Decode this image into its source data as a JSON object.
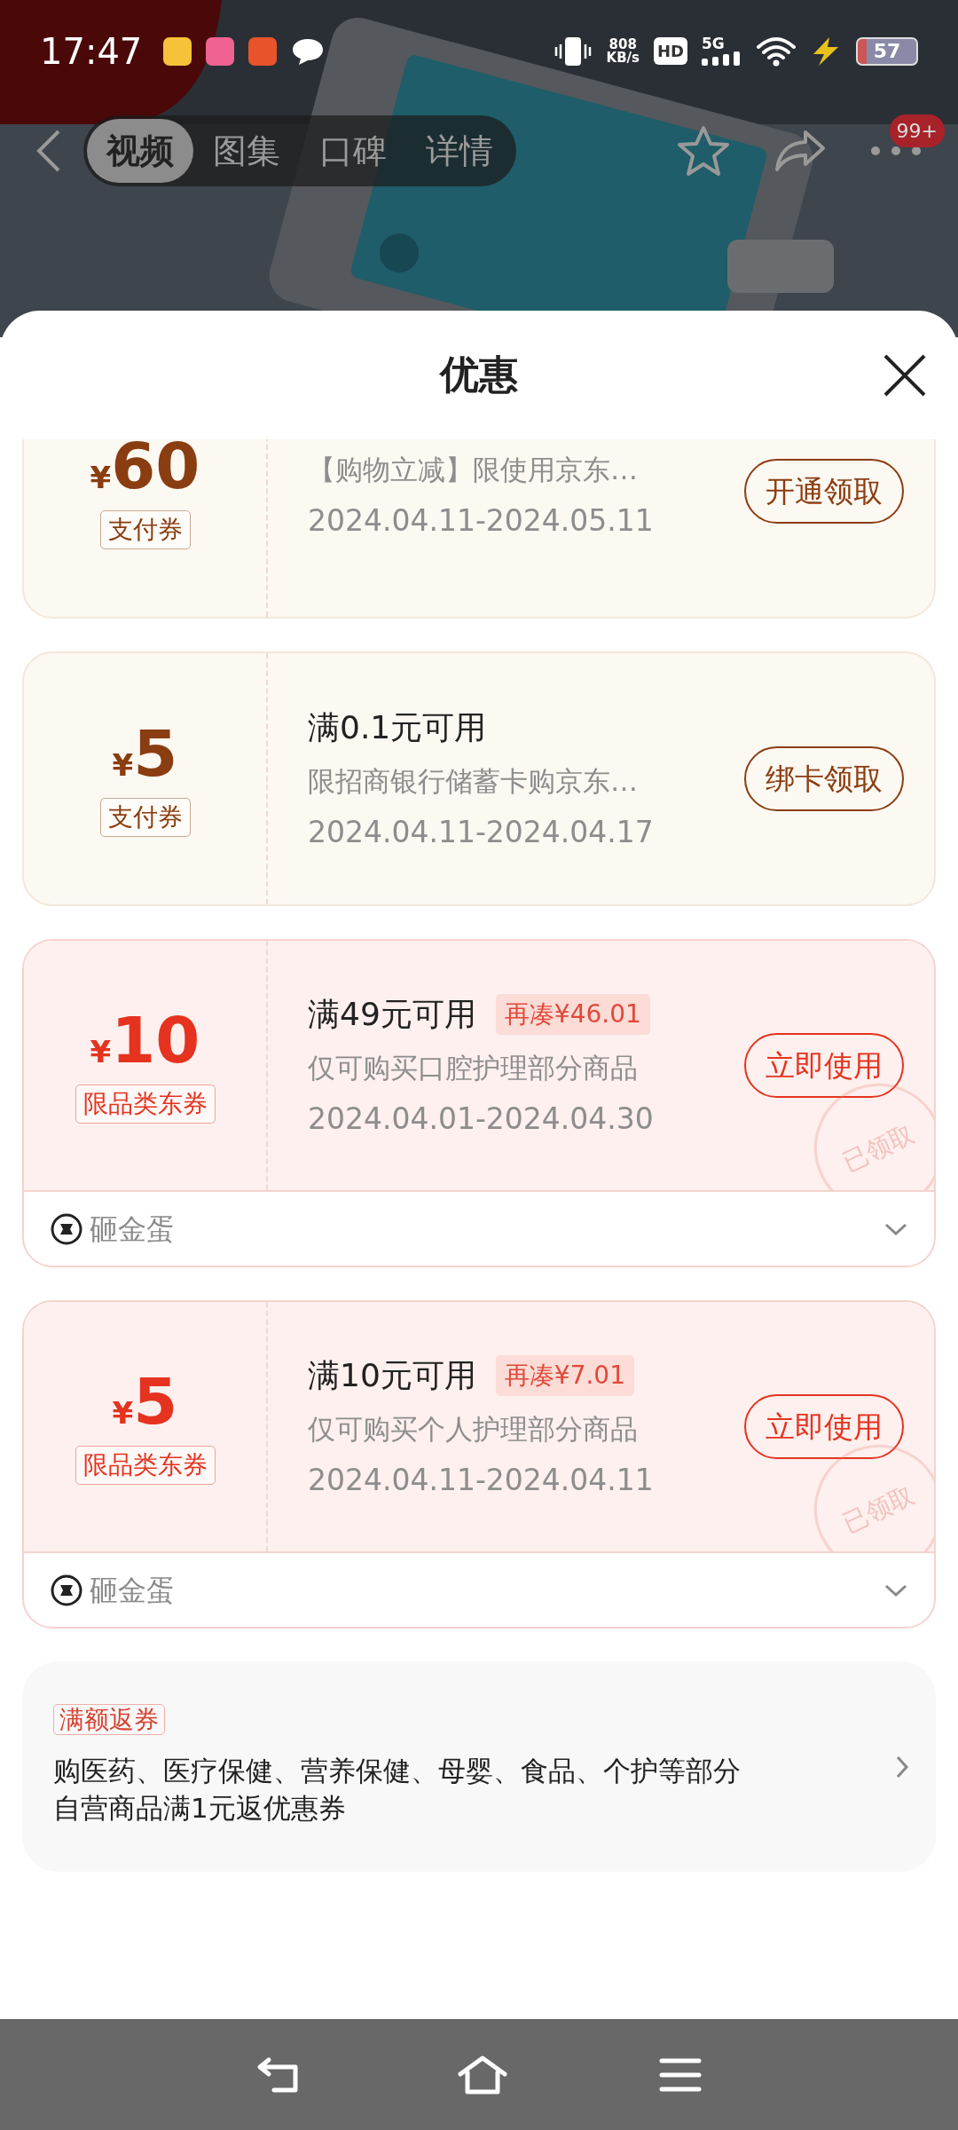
{
  "status_bar": {
    "time": "17:47",
    "speed_value": "808",
    "speed_unit": "KB/s",
    "hd": "HD",
    "network": "5G",
    "battery": "57"
  },
  "top_nav": {
    "tabs": [
      {
        "label": "视频",
        "selected": true
      },
      {
        "label": "图集",
        "selected": false
      },
      {
        "label": "口碑",
        "selected": false
      },
      {
        "label": "详情",
        "selected": false
      }
    ],
    "badge": "99+"
  },
  "sheet": {
    "title": "优惠"
  },
  "coupons": [
    {
      "kind": "payment",
      "currency": "¥",
      "amount": "60",
      "tag": "支付券",
      "desc": "【购物立减】限使用京东…",
      "dates": "2024.04.11-2024.05.11",
      "button": "开通领取"
    },
    {
      "kind": "payment",
      "currency": "¥",
      "amount": "5",
      "tag": "支付券",
      "title": "满0.1元可用",
      "desc": "限招商银行储蓄卡购京东…",
      "dates": "2024.04.11-2024.04.17",
      "button": "绑卡领取"
    },
    {
      "kind": "category",
      "currency": "¥",
      "amount": "10",
      "tag": "限品类东券",
      "title": "满49元可用",
      "gap": "再凑¥46.01",
      "desc": "仅可购买口腔护理部分商品",
      "dates": "2024.04.01-2024.04.30",
      "button": "立即使用",
      "stamp": "已领取",
      "footer": "砸金蛋"
    },
    {
      "kind": "category",
      "currency": "¥",
      "amount": "5",
      "tag": "限品类东券",
      "title": "满10元可用",
      "gap": "再凑¥7.01",
      "desc": "仅可购买个人护理部分商品",
      "dates": "2024.04.11-2024.04.11",
      "button": "立即使用",
      "stamp": "已领取",
      "footer": "砸金蛋"
    }
  ],
  "banner": {
    "tag": "满额返券",
    "text": "购医药、医疗保健、营养保健、母婴、食品、个护等部分自营商品满1元返优惠券"
  }
}
